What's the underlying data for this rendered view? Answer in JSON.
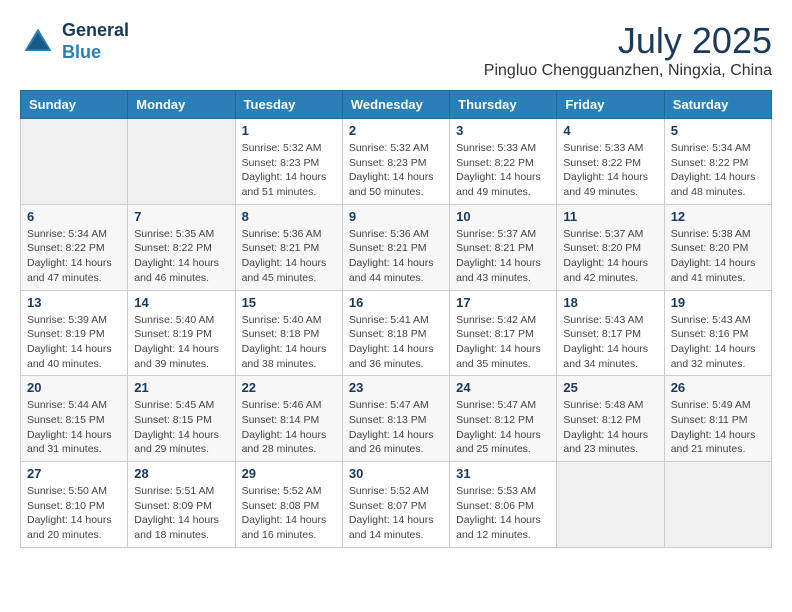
{
  "header": {
    "logo_line1": "General",
    "logo_line2": "Blue",
    "month": "July 2025",
    "location": "Pingluo Chengguanzhen, Ningxia, China"
  },
  "weekdays": [
    "Sunday",
    "Monday",
    "Tuesday",
    "Wednesday",
    "Thursday",
    "Friday",
    "Saturday"
  ],
  "weeks": [
    [
      {
        "day": "",
        "info": ""
      },
      {
        "day": "",
        "info": ""
      },
      {
        "day": "1",
        "info": "Sunrise: 5:32 AM\nSunset: 8:23 PM\nDaylight: 14 hours\nand 51 minutes."
      },
      {
        "day": "2",
        "info": "Sunrise: 5:32 AM\nSunset: 8:23 PM\nDaylight: 14 hours\nand 50 minutes."
      },
      {
        "day": "3",
        "info": "Sunrise: 5:33 AM\nSunset: 8:22 PM\nDaylight: 14 hours\nand 49 minutes."
      },
      {
        "day": "4",
        "info": "Sunrise: 5:33 AM\nSunset: 8:22 PM\nDaylight: 14 hours\nand 49 minutes."
      },
      {
        "day": "5",
        "info": "Sunrise: 5:34 AM\nSunset: 8:22 PM\nDaylight: 14 hours\nand 48 minutes."
      }
    ],
    [
      {
        "day": "6",
        "info": "Sunrise: 5:34 AM\nSunset: 8:22 PM\nDaylight: 14 hours\nand 47 minutes."
      },
      {
        "day": "7",
        "info": "Sunrise: 5:35 AM\nSunset: 8:22 PM\nDaylight: 14 hours\nand 46 minutes."
      },
      {
        "day": "8",
        "info": "Sunrise: 5:36 AM\nSunset: 8:21 PM\nDaylight: 14 hours\nand 45 minutes."
      },
      {
        "day": "9",
        "info": "Sunrise: 5:36 AM\nSunset: 8:21 PM\nDaylight: 14 hours\nand 44 minutes."
      },
      {
        "day": "10",
        "info": "Sunrise: 5:37 AM\nSunset: 8:21 PM\nDaylight: 14 hours\nand 43 minutes."
      },
      {
        "day": "11",
        "info": "Sunrise: 5:37 AM\nSunset: 8:20 PM\nDaylight: 14 hours\nand 42 minutes."
      },
      {
        "day": "12",
        "info": "Sunrise: 5:38 AM\nSunset: 8:20 PM\nDaylight: 14 hours\nand 41 minutes."
      }
    ],
    [
      {
        "day": "13",
        "info": "Sunrise: 5:39 AM\nSunset: 8:19 PM\nDaylight: 14 hours\nand 40 minutes."
      },
      {
        "day": "14",
        "info": "Sunrise: 5:40 AM\nSunset: 8:19 PM\nDaylight: 14 hours\nand 39 minutes."
      },
      {
        "day": "15",
        "info": "Sunrise: 5:40 AM\nSunset: 8:18 PM\nDaylight: 14 hours\nand 38 minutes."
      },
      {
        "day": "16",
        "info": "Sunrise: 5:41 AM\nSunset: 8:18 PM\nDaylight: 14 hours\nand 36 minutes."
      },
      {
        "day": "17",
        "info": "Sunrise: 5:42 AM\nSunset: 8:17 PM\nDaylight: 14 hours\nand 35 minutes."
      },
      {
        "day": "18",
        "info": "Sunrise: 5:43 AM\nSunset: 8:17 PM\nDaylight: 14 hours\nand 34 minutes."
      },
      {
        "day": "19",
        "info": "Sunrise: 5:43 AM\nSunset: 8:16 PM\nDaylight: 14 hours\nand 32 minutes."
      }
    ],
    [
      {
        "day": "20",
        "info": "Sunrise: 5:44 AM\nSunset: 8:15 PM\nDaylight: 14 hours\nand 31 minutes."
      },
      {
        "day": "21",
        "info": "Sunrise: 5:45 AM\nSunset: 8:15 PM\nDaylight: 14 hours\nand 29 minutes."
      },
      {
        "day": "22",
        "info": "Sunrise: 5:46 AM\nSunset: 8:14 PM\nDaylight: 14 hours\nand 28 minutes."
      },
      {
        "day": "23",
        "info": "Sunrise: 5:47 AM\nSunset: 8:13 PM\nDaylight: 14 hours\nand 26 minutes."
      },
      {
        "day": "24",
        "info": "Sunrise: 5:47 AM\nSunset: 8:12 PM\nDaylight: 14 hours\nand 25 minutes."
      },
      {
        "day": "25",
        "info": "Sunrise: 5:48 AM\nSunset: 8:12 PM\nDaylight: 14 hours\nand 23 minutes."
      },
      {
        "day": "26",
        "info": "Sunrise: 5:49 AM\nSunset: 8:11 PM\nDaylight: 14 hours\nand 21 minutes."
      }
    ],
    [
      {
        "day": "27",
        "info": "Sunrise: 5:50 AM\nSunset: 8:10 PM\nDaylight: 14 hours\nand 20 minutes."
      },
      {
        "day": "28",
        "info": "Sunrise: 5:51 AM\nSunset: 8:09 PM\nDaylight: 14 hours\nand 18 minutes."
      },
      {
        "day": "29",
        "info": "Sunrise: 5:52 AM\nSunset: 8:08 PM\nDaylight: 14 hours\nand 16 minutes."
      },
      {
        "day": "30",
        "info": "Sunrise: 5:52 AM\nSunset: 8:07 PM\nDaylight: 14 hours\nand 14 minutes."
      },
      {
        "day": "31",
        "info": "Sunrise: 5:53 AM\nSunset: 8:06 PM\nDaylight: 14 hours\nand 12 minutes."
      },
      {
        "day": "",
        "info": ""
      },
      {
        "day": "",
        "info": ""
      }
    ]
  ]
}
